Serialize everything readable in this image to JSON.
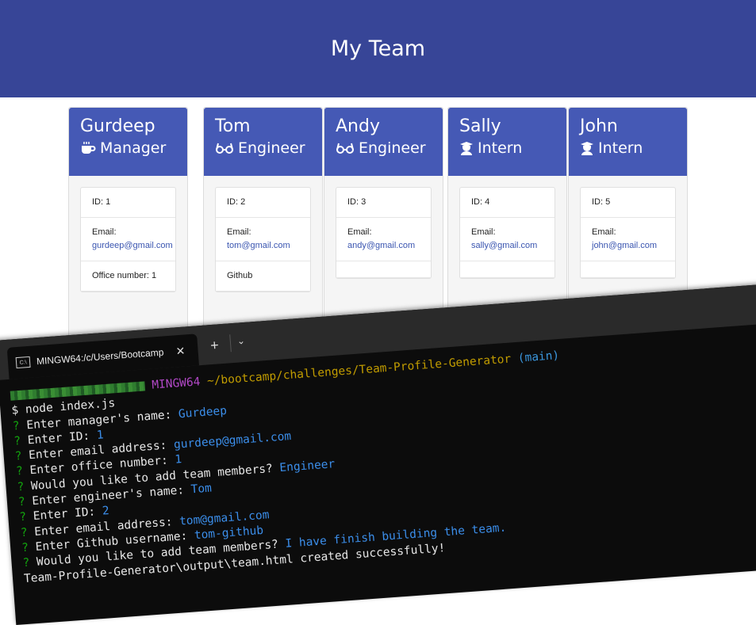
{
  "page": {
    "title": "My Team"
  },
  "team": [
    {
      "name": "Gurdeep",
      "role": "Manager",
      "role_icon": "coffee-icon",
      "id": "ID: 1",
      "email_label": "Email:",
      "email": "gurdeep@gmail.com",
      "extra": "Office number: 1"
    },
    {
      "name": "Tom",
      "role": "Engineer",
      "role_icon": "glasses-icon",
      "id": "ID: 2",
      "email_label": "Email:",
      "email": "tom@gmail.com",
      "extra": "Github"
    },
    {
      "name": "Andy",
      "role": "Engineer",
      "role_icon": "glasses-icon",
      "id": "ID: 3",
      "email_label": "Email:",
      "email": "andy@gmail.com",
      "extra": ""
    },
    {
      "name": "Sally",
      "role": "Intern",
      "role_icon": "graduate-icon",
      "id": "ID: 4",
      "email_label": "Email:",
      "email": "sally@gmail.com",
      "extra": ""
    },
    {
      "name": "John",
      "role": "Intern",
      "role_icon": "graduate-icon",
      "id": "ID: 5",
      "email_label": "Email:",
      "email": "john@gmail.com",
      "extra": ""
    }
  ],
  "terminal": {
    "tab_title": "MINGW64:/c/Users/Bootcamp",
    "tab_icon": "terminal-icon",
    "prompt_host": "MINGW64",
    "prompt_path": "~/bootcamp/challenges/Team-Profile-Generator",
    "prompt_branch": "(main)",
    "command": "$ node index.js",
    "lines": [
      {
        "q": "Enter manager's name:",
        "a": "Gurdeep"
      },
      {
        "q": "Enter ID:",
        "a": "1"
      },
      {
        "q": "Enter email address:",
        "a": "gurdeep@gmail.com"
      },
      {
        "q": "Enter office number:",
        "a": "1"
      },
      {
        "q": "Would you like to add team members?",
        "a": "Engineer"
      },
      {
        "q": "Enter engineer's name:",
        "a": "Tom"
      },
      {
        "q": "Enter ID:",
        "a": "2"
      },
      {
        "q": "Enter email address:",
        "a": "tom@gmail.com"
      },
      {
        "q": "Enter Github username:",
        "a": "tom-github"
      },
      {
        "q": "Would you like to add team members?",
        "a": "I have finish building the team."
      }
    ],
    "result": "Team-Profile-Generator\\output\\team.html created successfully!"
  },
  "colors": {
    "header": "#374597",
    "card_head": "#4559b5",
    "terminal_bg": "#0c0c0c"
  }
}
